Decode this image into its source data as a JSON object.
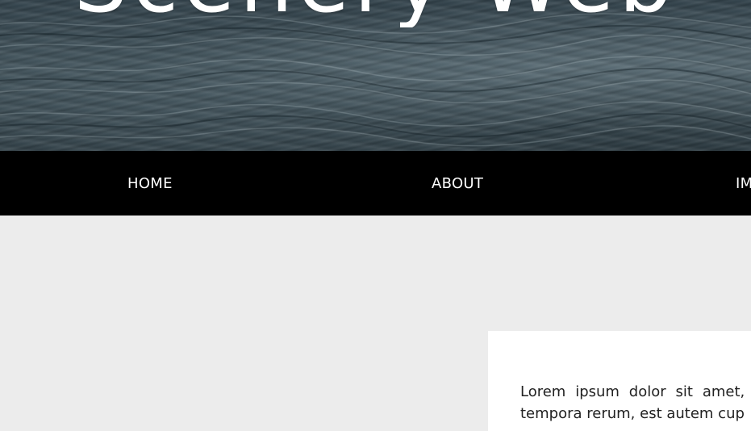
{
  "hero": {
    "title": "Scenery Web"
  },
  "nav": {
    "items": [
      {
        "label": "HOME"
      },
      {
        "label": "ABOUT"
      },
      {
        "label": "IM"
      }
    ]
  },
  "content": {
    "paragraph": "Lorem ipsum dolor sit amet, c tempora rerum, est autem cup"
  },
  "colors": {
    "page_background": "#ececec",
    "nav_background": "#000000",
    "nav_text": "#ffffff",
    "card_background": "#ffffff",
    "hero_water": "#3a4a52"
  }
}
